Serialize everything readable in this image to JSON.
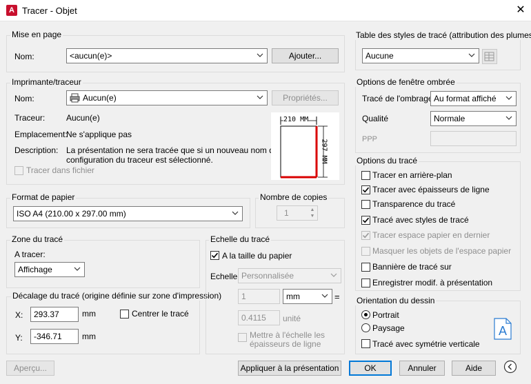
{
  "window": {
    "title": "Tracer - Objet",
    "app_icon": "A"
  },
  "mise_en_page": {
    "legend": "Mise en page",
    "nom_label": "Nom:",
    "nom_value": "<aucun(e)>",
    "ajouter": "Ajouter..."
  },
  "imprimante": {
    "legend": "Imprimante/traceur",
    "nom_label": "Nom:",
    "nom_value": "Aucun(e)",
    "proprietes": "Propriétés...",
    "traceur_label": "Traceur:",
    "traceur_value": "Aucun(e)",
    "emplacement_label": "Emplacement:",
    "emplacement_value": "Ne s'applique pas",
    "description_label": "Description:",
    "description_line1": "La présentation ne sera tracée que si un nouveau nom de",
    "description_line2": "configuration du traceur est sélectionné.",
    "tracer_fichier": "Tracer dans fichier",
    "paper_width": "210 MM",
    "paper_height": "297 MM"
  },
  "format_papier": {
    "legend": "Format de papier",
    "value": "ISO A4 (210.00 x 297.00 mm)"
  },
  "copies": {
    "legend": "Nombre de copies",
    "value": "1"
  },
  "zone": {
    "legend": "Zone du tracé",
    "a_tracer_label": "A tracer:",
    "value": "Affichage"
  },
  "decalage": {
    "legend": "Décalage du tracé (origine définie sur zone d'impression)",
    "x_label": "X:",
    "x_value": "293.37",
    "x_unit": "mm",
    "y_label": "Y:",
    "y_value": "-346.71",
    "y_unit": "mm",
    "centrer": "Centrer le tracé"
  },
  "echelle": {
    "legend": "Echelle du tracé",
    "taille_papier": "A la taille du papier",
    "echelle_label": "Echelle:",
    "echelle_value": "Personnalisée",
    "val1": "1",
    "unit_value": "mm",
    "equals": "=",
    "val2": "0.4115",
    "unite": "unité",
    "mettre_line1": "Mettre à l'échelle les",
    "mettre_line2": "épaisseurs de ligne"
  },
  "styles": {
    "legend": "Table des styles de tracé (attribution des plumes)",
    "value": "Aucune"
  },
  "ombree": {
    "legend": "Options de fenêtre ombrée",
    "trace_label": "Tracé de l'ombrage",
    "trace_value": "Au format affiché",
    "qualite_label": "Qualité",
    "qualite_value": "Normale",
    "ppp_label": "PPP"
  },
  "options": {
    "legend": "Options du tracé",
    "items": [
      {
        "label": "Tracer en arrière-plan",
        "checked": false,
        "disabled": false
      },
      {
        "label": "Tracer avec épaisseurs de ligne",
        "checked": true,
        "disabled": false
      },
      {
        "label": "Transparence du tracé",
        "checked": false,
        "disabled": false
      },
      {
        "label": "Tracé avec styles de tracé",
        "checked": true,
        "disabled": false
      },
      {
        "label": "Tracer espace papier en dernier",
        "checked": true,
        "disabled": true
      },
      {
        "label": "Masquer les objets de l'espace papier",
        "checked": false,
        "disabled": true
      },
      {
        "label": "Bannière de tracé sur",
        "checked": false,
        "disabled": false
      },
      {
        "label": "Enregistrer modif. à présentation",
        "checked": false,
        "disabled": false
      }
    ]
  },
  "orientation": {
    "legend": "Orientation du dessin",
    "portrait": "Portrait",
    "paysage": "Paysage",
    "symetrie": "Tracé avec symétrie verticale",
    "icon_letter": "A"
  },
  "footer": {
    "apercu": "Aperçu...",
    "appliquer": "Appliquer à la présentation",
    "ok": "OK",
    "annuler": "Annuler",
    "aide": "Aide"
  },
  "colors": {
    "accent": "#0078d7",
    "paper_edge": "#d90000"
  }
}
